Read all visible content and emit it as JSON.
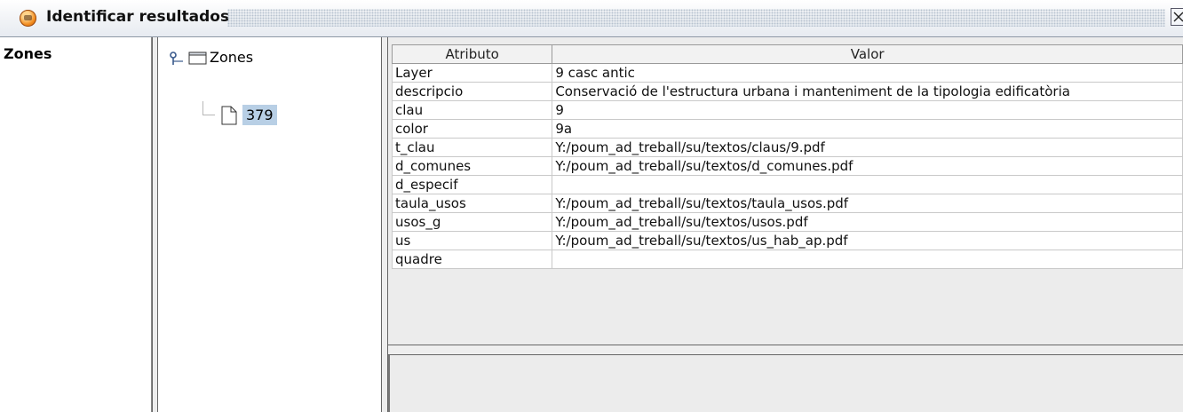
{
  "window": {
    "title": "Identificar resultados"
  },
  "left_pane": {
    "title": "Zones"
  },
  "tree": {
    "root_label": "Zones",
    "child_label": "379"
  },
  "table": {
    "headers": [
      "Atributo",
      "Valor"
    ],
    "rows": [
      [
        "Layer",
        "9 casc antic"
      ],
      [
        "descripcio",
        "Conservació de l'estructura urbana i manteniment de la tipologia edificatòria"
      ],
      [
        "clau",
        "9"
      ],
      [
        "color",
        "9a"
      ],
      [
        "t_clau",
        "Y:/poum_ad_treball/su/textos/claus/9.pdf"
      ],
      [
        "d_comunes",
        "Y:/poum_ad_treball/su/textos/d_comunes.pdf"
      ],
      [
        "d_especif",
        ""
      ],
      [
        "taula_usos",
        "Y:/poum_ad_treball/su/textos/taula_usos.pdf"
      ],
      [
        "usos_g",
        "Y:/poum_ad_treball/su/textos/usos.pdf"
      ],
      [
        "us",
        "Y:/poum_ad_treball/su/textos/us_hab_ap.pdf"
      ],
      [
        "quadre",
        ""
      ]
    ]
  },
  "colors": {
    "selection": "#b8cfe5",
    "panel": "#ececec"
  }
}
